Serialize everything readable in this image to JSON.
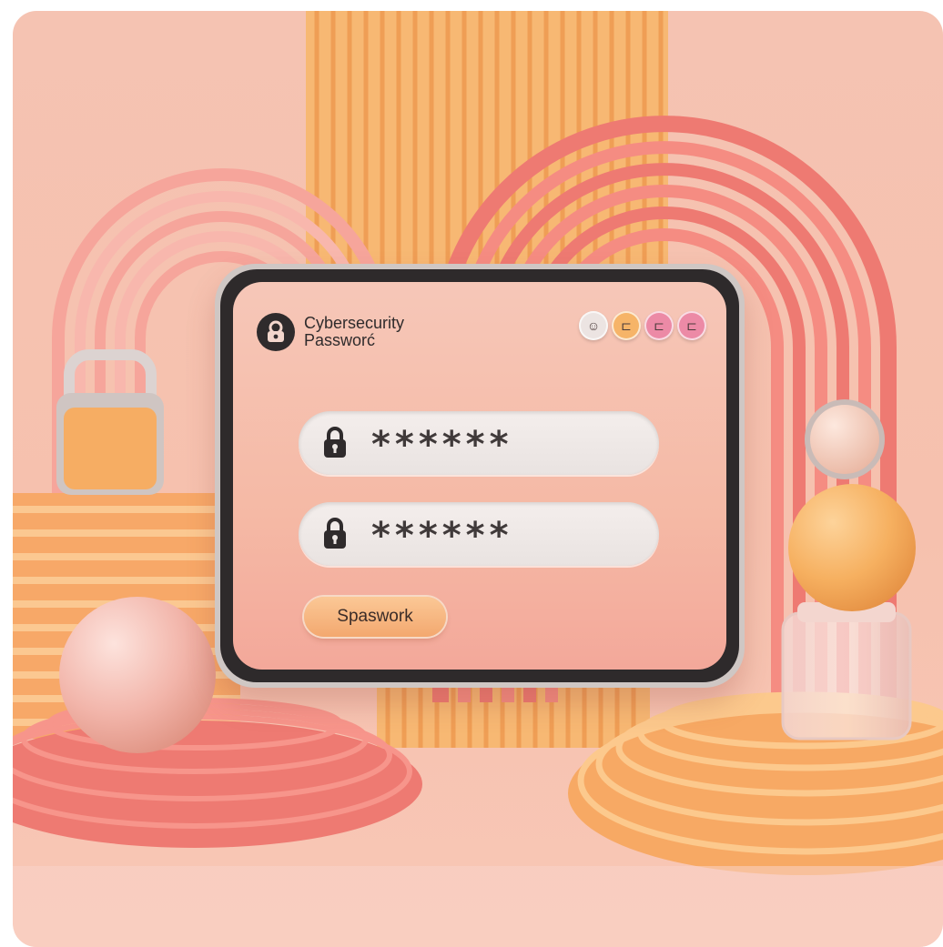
{
  "app": {
    "title_line1": "Cybersecurity",
    "title_line2": "Passworć",
    "logo_icon": "user-lock-icon"
  },
  "header_icons": [
    {
      "name": "user-icon",
      "glyph": "☺",
      "color": "#ece4e2"
    },
    {
      "name": "flag-icon",
      "glyph": "⊏",
      "color": "#f6b468"
    },
    {
      "name": "flag-icon",
      "glyph": "⊏",
      "color": "#ec8aa6"
    },
    {
      "name": "flag-icon",
      "glyph": "⊏",
      "color": "#ec8aa6"
    }
  ],
  "form": {
    "password_field_1": {
      "value": "******",
      "icon": "lock-icon"
    },
    "password_field_2": {
      "value": "******",
      "icon": "lock-icon"
    },
    "submit_label": "Spaswork"
  },
  "colors": {
    "accent": "#f3a86f",
    "background": "#f5c3b2",
    "coral": "#f07870",
    "dark": "#2e2a2b"
  }
}
